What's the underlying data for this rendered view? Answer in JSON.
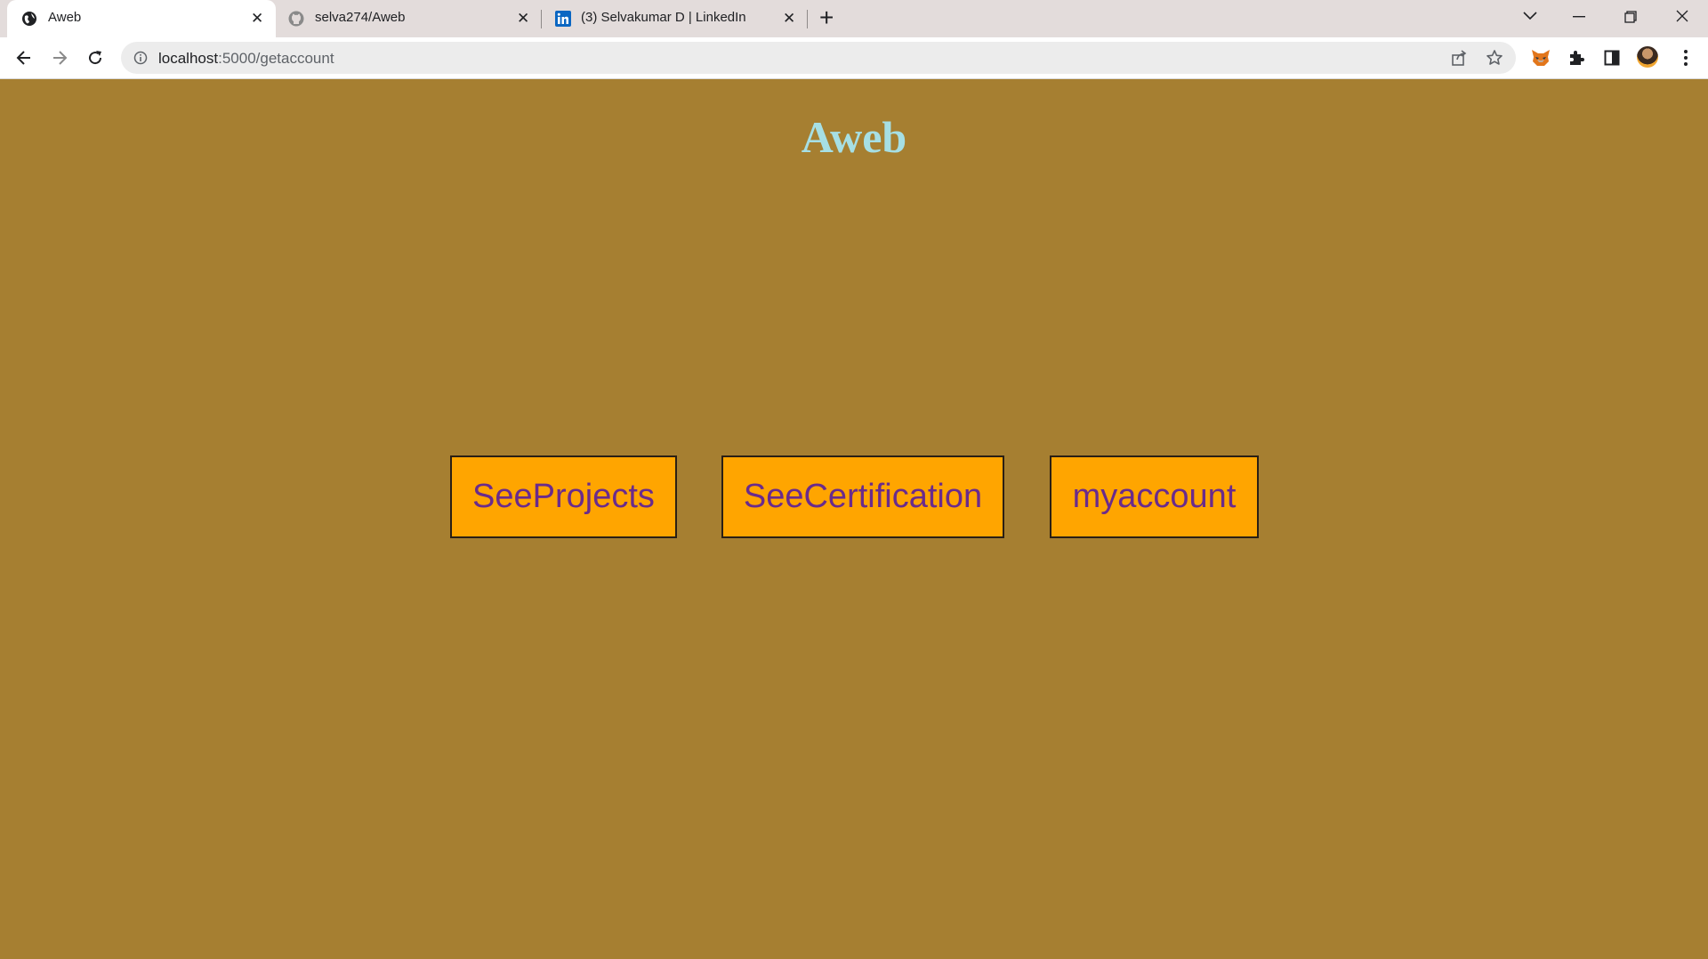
{
  "browser": {
    "tabs": [
      {
        "title": "Aweb",
        "favicon": "globe-icon",
        "active": true
      },
      {
        "title": "selva274/Aweb",
        "favicon": "github-icon",
        "active": false
      },
      {
        "title": "(3) Selvakumar D | LinkedIn",
        "favicon": "linkedin-icon",
        "active": false
      }
    ],
    "url_host": "localhost",
    "url_path": ":5000/getaccount"
  },
  "page": {
    "title": "Aweb",
    "background_color": "#a67f31",
    "title_color": "#a6dfe4",
    "button_bg_color": "#ffa500",
    "button_text_color": "#6a2b8c",
    "buttons": [
      {
        "label": "SeeProjects"
      },
      {
        "label": "SeeCertification"
      },
      {
        "label": "myaccount"
      }
    ]
  }
}
